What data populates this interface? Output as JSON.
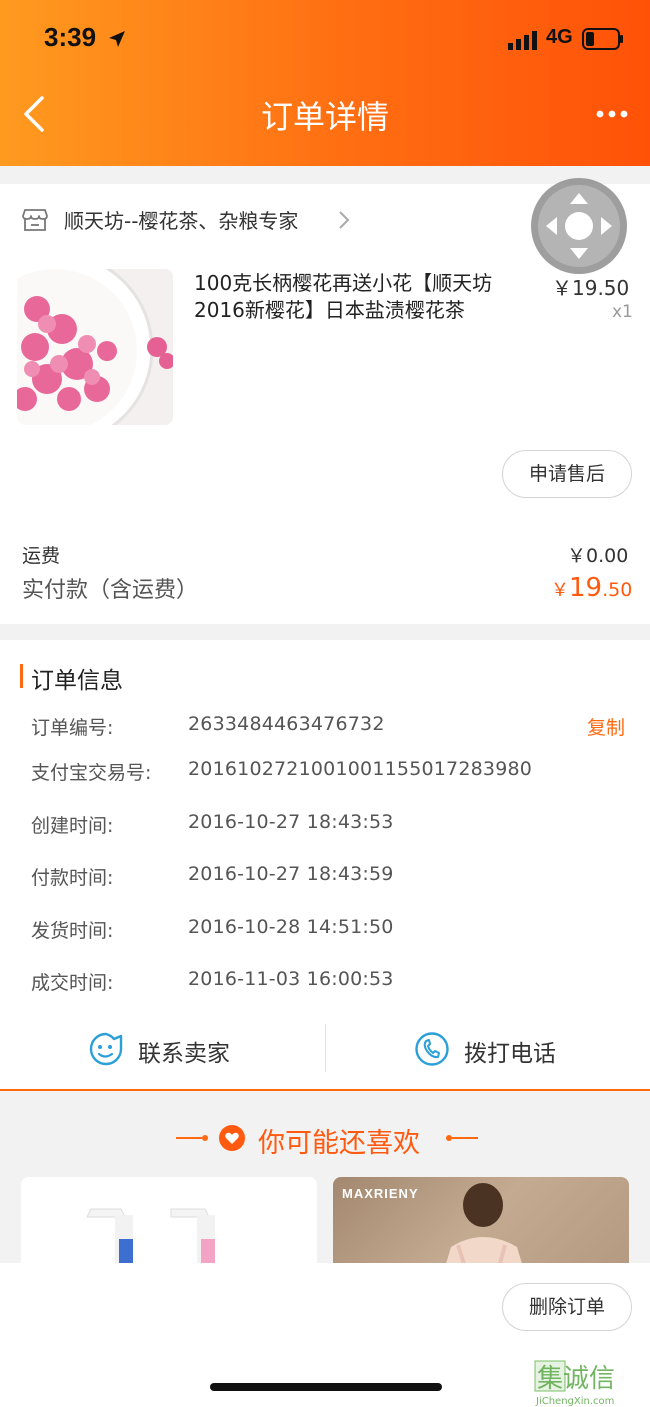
{
  "status": {
    "time": "3:39",
    "network": "4G"
  },
  "nav": {
    "title": "订单详情"
  },
  "shop": {
    "name": "顺天坊--樱花茶、杂粮专家"
  },
  "product": {
    "title": "100克长柄樱花再送小花【顺天坊2016新樱花】日本盐渍樱花茶",
    "price": "￥19.50",
    "qty": "x1",
    "after_sale_label": "申请售后"
  },
  "fees": {
    "shipping_label": "运费",
    "shipping_value": "￥0.00",
    "paid_label": "实付款（含运费）",
    "paid_yen": "￥",
    "paid_int": "19",
    "paid_dec": ".50"
  },
  "order_info": {
    "title": "订单信息",
    "copy_label": "复制",
    "rows": [
      {
        "label": "订单编号:",
        "value": "2633484463476732"
      },
      {
        "label": "支付宝交易号:",
        "value": "2016102721001001155017283980"
      },
      {
        "label": "创建时间:",
        "value": "2016-10-27 18:43:53"
      },
      {
        "label": "付款时间:",
        "value": "2016-10-27 18:43:59"
      },
      {
        "label": "发货时间:",
        "value": "2016-10-28 14:51:50"
      },
      {
        "label": "成交时间:",
        "value": "2016-11-03 16:00:53"
      }
    ]
  },
  "contact": {
    "seller_label": "联系卖家",
    "call_label": "拨打电话"
  },
  "recommend": {
    "title": "你可能还喜欢",
    "brand": "MAXRIENY"
  },
  "footer": {
    "delete_label": "删除订单"
  },
  "watermark": {
    "text": "集诚信",
    "sub": "JiChengXin.com"
  },
  "colors": {
    "accent": "#ff6a10",
    "header_start": "#ff9a1f",
    "header_end": "#ff5208"
  },
  "icons": [
    "location-arrow-icon",
    "signal-icon",
    "battery-icon",
    "back-chevron-icon",
    "more-dots-icon",
    "shop-icon",
    "chevron-right-icon",
    "chat-face-icon",
    "phone-icon",
    "heart-icon",
    "joystick-icon"
  ]
}
